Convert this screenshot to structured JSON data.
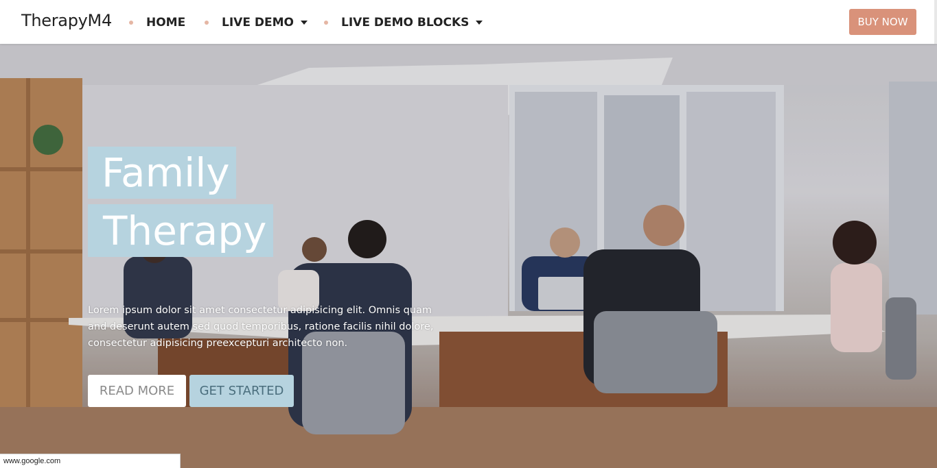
{
  "nav": {
    "brand": "TherapyM4",
    "items": [
      {
        "label": "HOME"
      },
      {
        "label": "LIVE DEMO"
      },
      {
        "label": "LIVE DEMO BLOCKS"
      }
    ],
    "buy_label": "BUY NOW"
  },
  "hero": {
    "title_line1": "Family",
    "title_line2": "Therapy",
    "body": "Lorem ipsum dolor sit amet consectetur adipisicing elit. Omnis quam and deserunt autem sed quod temporibus, ratione facilis nihil dolore, consectetur adipisicing preexcepturi architecto non.",
    "read_more": "READ MORE",
    "get_started": "GET STARTED"
  },
  "status_bar": {
    "url": "www.google.com"
  },
  "colors": {
    "accent_button": "#d9927a",
    "title_block": "#b6d3df",
    "nav_dot": "#e5b6a4"
  }
}
